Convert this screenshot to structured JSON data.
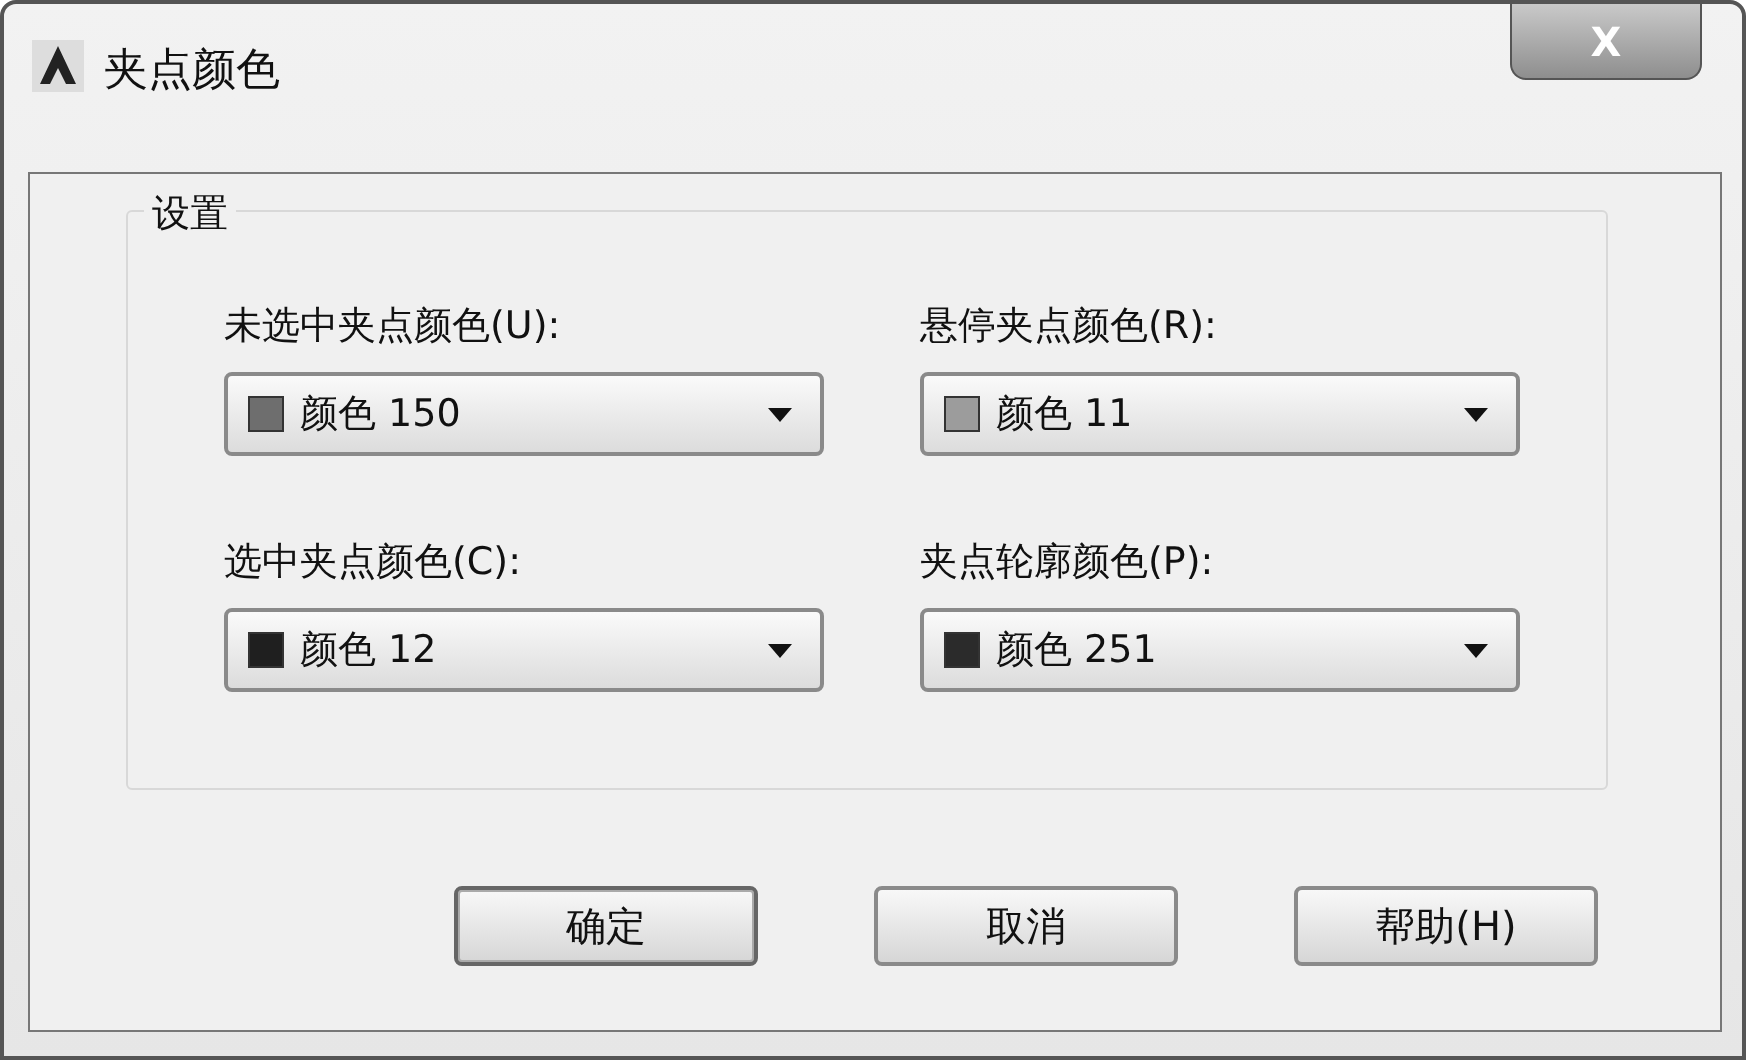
{
  "window": {
    "title": "夹点颜色",
    "close": "X"
  },
  "group": {
    "title": "设置"
  },
  "fields": [
    {
      "label": "未选中夹点颜色(U):",
      "value": "颜色 150",
      "color": "#6e6e6e"
    },
    {
      "label": "悬停夹点颜色(R):",
      "value": "颜色 11",
      "color": "#9c9c9c"
    },
    {
      "label": "选中夹点颜色(C):",
      "value": "颜色 12",
      "color": "#1f1f1f"
    },
    {
      "label": "夹点轮廓颜色(P):",
      "value": "颜色 251",
      "color": "#2b2b2b"
    }
  ],
  "buttons": [
    "确定",
    "取消",
    "帮助(H)"
  ]
}
